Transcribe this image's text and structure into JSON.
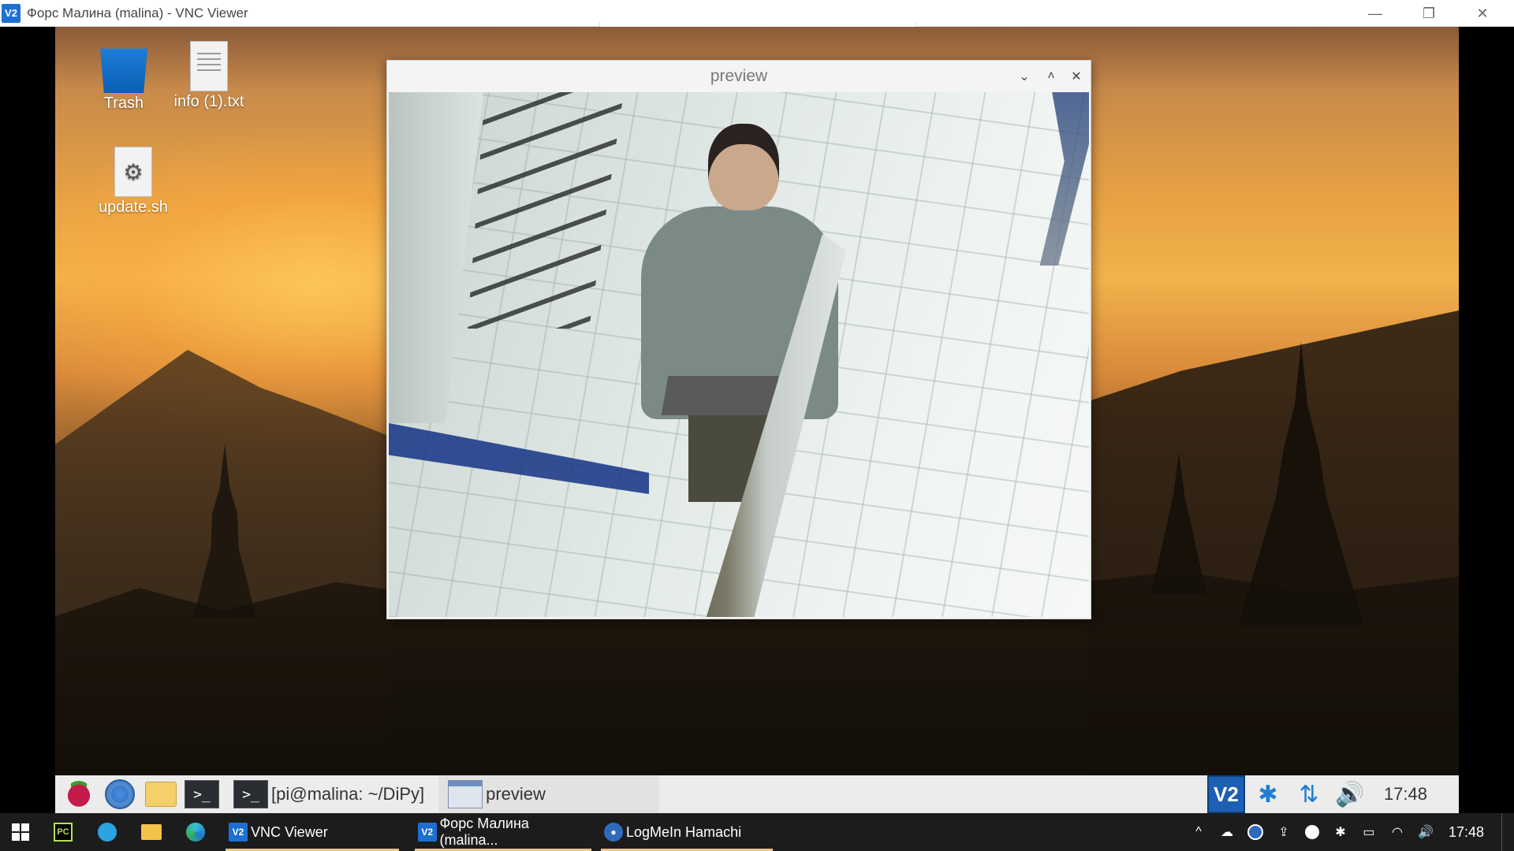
{
  "vnc_window": {
    "app_icon": "V2",
    "title": "Форс Малина (malina) - VNC Viewer",
    "minimize_glyph": "—",
    "restore_glyph": "❐",
    "close_glyph": "✕"
  },
  "desktop": {
    "icons": [
      {
        "label": "Trash",
        "icon": "trash-icon"
      },
      {
        "label": "info (1).txt",
        "icon": "text-file-icon"
      },
      {
        "label": "update.sh",
        "icon": "script-file-icon"
      }
    ],
    "sh_glyph": "⚙"
  },
  "preview_window": {
    "title": "preview",
    "collapse_glyph": "⌄",
    "maximize_glyph": "˄",
    "close_glyph": "✕"
  },
  "pi_panel": {
    "terminal_glyph": ">_",
    "tasks": [
      {
        "label": "[pi@malina: ~/DiPy]",
        "icon": "terminal-icon"
      },
      {
        "label": "preview",
        "icon": "window-icon"
      }
    ],
    "tray": {
      "vnc_label": "V2",
      "bluetooth_glyph": "✱",
      "network_glyph": "⇅",
      "volume_glyph": "🔊",
      "clock": "17:48"
    }
  },
  "win_taskbar": {
    "pins": [
      "start-icon",
      "pycharm-icon",
      "telegram-icon",
      "file-explorer-icon",
      "edge-icon"
    ],
    "pycharm_label": "PC",
    "apps": [
      {
        "label": "VNC Viewer",
        "icon_text": "V2"
      },
      {
        "label": "Форс Малина (malina...",
        "icon_text": "V2"
      },
      {
        "label": "LogMeIn Hamachi",
        "icon_text": "●"
      }
    ],
    "tray": {
      "chevron_glyph": "^",
      "cloud_glyph": "☁",
      "upload_glyph": "⇪",
      "bluetooth_glyph": "✱",
      "battery_glyph": "▭",
      "wifi_glyph": "◠",
      "volume_glyph": "🔊",
      "clock": "17:48"
    }
  }
}
